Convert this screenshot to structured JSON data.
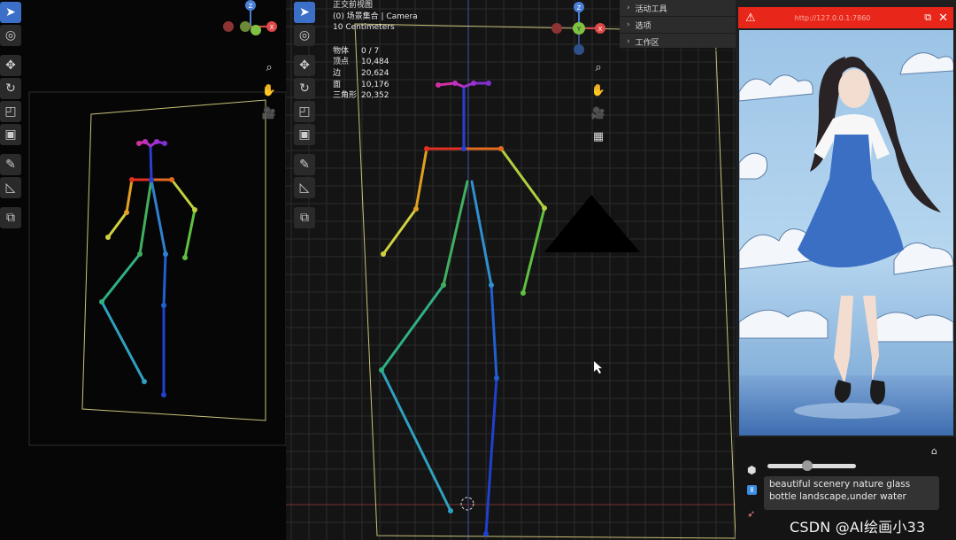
{
  "viewport": {
    "view_name": "正交前视图",
    "collection": "(0) 场景集合 | Camera",
    "scale": "10 Centimeters",
    "stats": [
      {
        "label": "物体",
        "value": "0 / 7"
      },
      {
        "label": "顶点",
        "value": "10,484"
      },
      {
        "label": "边",
        "value": "20,624"
      },
      {
        "label": "面",
        "value": "10,176"
      },
      {
        "label": "三角形",
        "value": "20,352"
      }
    ],
    "gizmo_labels": {
      "z": "Z",
      "y": "Y",
      "x": "X"
    }
  },
  "side_panel": {
    "items": [
      {
        "label": "活动工具"
      },
      {
        "label": "选项"
      },
      {
        "label": "工作区"
      }
    ]
  },
  "preview_window": {
    "url": "http://127.0.0.1:7860",
    "header_color": "#e8261a"
  },
  "prompt": {
    "text": "beautiful scenery nature glass bottle landscape,under water"
  },
  "slider": {
    "value": 0.45
  },
  "watermark": "CSDN @AI绘画小33",
  "colors": {
    "active_tool": "#3b6fc8",
    "axis_x": "#e04848",
    "axis_y": "#7fc242",
    "axis_z": "#4a7fd6"
  }
}
